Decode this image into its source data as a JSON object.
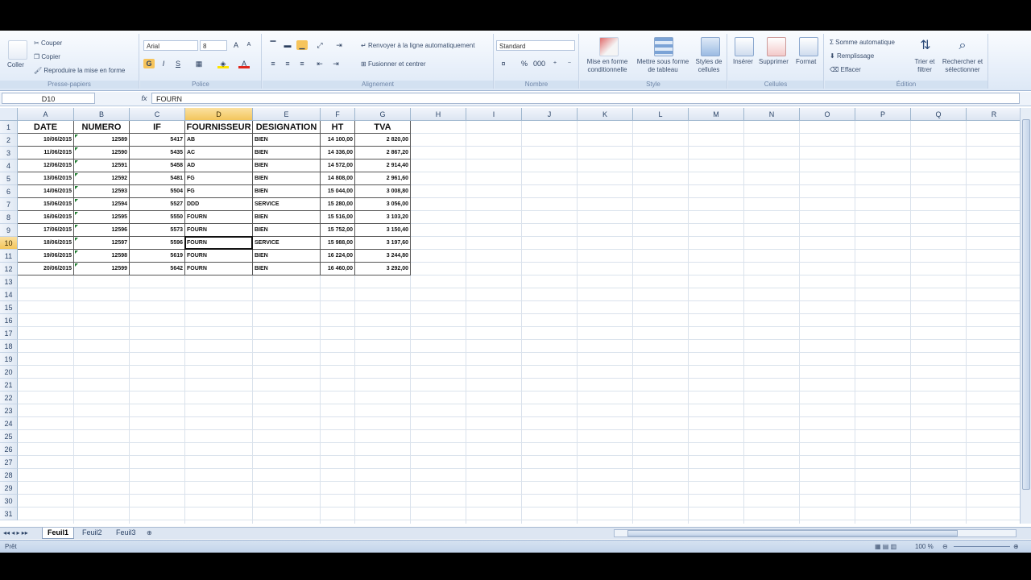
{
  "ribbon": {
    "clipboard": {
      "paste_label": "Coller",
      "cut_label": "Couper",
      "copy_label": "Copier",
      "format_painter_label": "Reproduire la mise en forme",
      "group_label": "Presse-papiers"
    },
    "font": {
      "font_name": "Arial",
      "font_size": "8",
      "group_label": "Police",
      "bold": "G",
      "italic": "I",
      "underline": "S"
    },
    "alignment": {
      "wrap_label": "Renvoyer à la ligne automatiquement",
      "merge_label": "Fusionner et centrer",
      "group_label": "Alignement"
    },
    "number": {
      "format": "Standard",
      "group_label": "Nombre"
    },
    "style": {
      "cond_label": "Mise en forme conditionnelle",
      "table_label": "Mettre sous forme de tableau",
      "cell_styles_label": "Styles de cellules",
      "group_label": "Style"
    },
    "cells": {
      "insert_label": "Insérer",
      "delete_label": "Supprimer",
      "format_label": "Format",
      "group_label": "Cellules"
    },
    "editing": {
      "autosum_label": "Somme automatique",
      "fill_label": "Remplissage",
      "clear_label": "Effacer",
      "sort_label": "Trier et filtrer",
      "find_label": "Rechercher et sélectionner",
      "group_label": "Édition"
    }
  },
  "formula_bar": {
    "name_box": "D10",
    "fx": "fx",
    "content": "FOURN"
  },
  "grid": {
    "columns": [
      "A",
      "B",
      "C",
      "D",
      "E",
      "F",
      "G",
      "H",
      "I",
      "J",
      "K",
      "L",
      "M",
      "N",
      "O",
      "P",
      "Q",
      "R"
    ],
    "selected_column": "D",
    "selected_row": 10,
    "row_count": 31,
    "headers": [
      "DATE",
      "NUMERO",
      "IF",
      "FOURNISSEUR",
      "DESIGNATION",
      "HT",
      "TVA"
    ],
    "rows": [
      [
        "10/06/2015",
        "12589",
        "5417",
        "AB",
        "BIEN",
        "14 100,00",
        "2 820,00"
      ],
      [
        "11/06/2015",
        "12590",
        "5435",
        "AC",
        "BIEN",
        "14 336,00",
        "2 867,20"
      ],
      [
        "12/06/2015",
        "12591",
        "5458",
        "AD",
        "BIEN",
        "14 572,00",
        "2 914,40"
      ],
      [
        "13/06/2015",
        "12592",
        "5481",
        "FG",
        "BIEN",
        "14 808,00",
        "2 961,60"
      ],
      [
        "14/06/2015",
        "12593",
        "5504",
        "FG",
        "BIEN",
        "15 044,00",
        "3 008,80"
      ],
      [
        "15/06/2015",
        "12594",
        "5527",
        "DDD",
        "SERVICE",
        "15 280,00",
        "3 056,00"
      ],
      [
        "16/06/2015",
        "12595",
        "5550",
        "FOURN",
        "BIEN",
        "15 516,00",
        "3 103,20"
      ],
      [
        "17/06/2015",
        "12596",
        "5573",
        "FOURN",
        "BIEN",
        "15 752,00",
        "3 150,40"
      ],
      [
        "18/06/2015",
        "12597",
        "5596",
        "FOURN",
        "SERVICE",
        "15 988,00",
        "3 197,60"
      ],
      [
        "19/06/2015",
        "12598",
        "5619",
        "FOURN",
        "BIEN",
        "16 224,00",
        "3 244,80"
      ],
      [
        "20/06/2015",
        "12599",
        "5642",
        "FOURN",
        "BIEN",
        "16 460,00",
        "3 292,00"
      ]
    ]
  },
  "sheets": [
    "Feuil1",
    "Feuil2",
    "Feuil3"
  ],
  "status": {
    "ready": "Prêt",
    "zoom": "100 %"
  }
}
